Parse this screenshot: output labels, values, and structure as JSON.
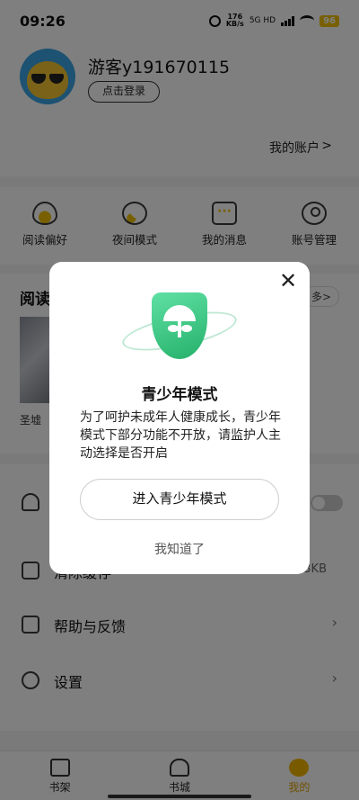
{
  "status_bar": {
    "time": "09:26",
    "net_speed_value": "176",
    "net_speed_unit": "KB/s",
    "network_type": "5G HD",
    "battery": "96"
  },
  "profile": {
    "username": "游客y191670115",
    "login_label": "点击登录",
    "account_link": "我的账户",
    "account_chevron": ">"
  },
  "quick_actions": [
    {
      "label": "阅读偏好",
      "icon": "heart-icon"
    },
    {
      "label": "夜间模式",
      "icon": "moon-icon"
    },
    {
      "label": "我的消息",
      "icon": "message-icon"
    },
    {
      "label": "账号管理",
      "icon": "user-icon"
    }
  ],
  "reading": {
    "title": "阅读",
    "more": "多>",
    "book_name": "圣墟"
  },
  "settings": [
    {
      "label": "",
      "icon": "bell-icon",
      "has_toggle": true
    },
    {
      "label": "清除缓存",
      "icon": "clean-icon",
      "value": "3KB"
    },
    {
      "label": "帮助与反馈",
      "icon": "feedback-icon"
    },
    {
      "label": "设置",
      "icon": "gear-icon"
    }
  ],
  "bottom_nav": [
    {
      "label": "书架",
      "icon": "book-icon",
      "active": false
    },
    {
      "label": "书城",
      "icon": "store-icon",
      "active": false
    },
    {
      "label": "我的",
      "icon": "me-icon",
      "active": true
    }
  ],
  "modal": {
    "title": "青少年模式",
    "description": "为了呵护未成年人健康成长，青少年模式下部分功能不开放，请监护人主动选择是否开启",
    "enter_label": "进入青少年模式",
    "dismiss_label": "我知道了",
    "close_glyph": "✕",
    "shield_icon": "shield-umbrella-icon"
  },
  "colors": {
    "accent": "#f0b400",
    "shield_green": "#25b06a"
  }
}
